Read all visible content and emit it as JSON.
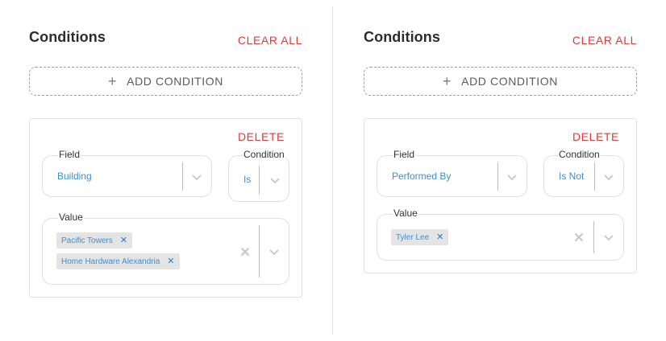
{
  "panels": [
    {
      "title": "Conditions",
      "clear_all_label": "CLEAR ALL",
      "add_condition_label": "ADD CONDITION",
      "condition": {
        "delete_label": "DELETE",
        "field": {
          "label": "Field",
          "value": "Building"
        },
        "operator": {
          "label": "Condition",
          "value": "Is"
        },
        "value": {
          "label": "Value",
          "chips": [
            "Pacific Towers",
            "Home Hardware Alexandria"
          ]
        }
      }
    },
    {
      "title": "Conditions",
      "clear_all_label": "CLEAR ALL",
      "add_condition_label": "ADD CONDITION",
      "condition": {
        "delete_label": "DELETE",
        "field": {
          "label": "Field",
          "value": "Performed By"
        },
        "operator": {
          "label": "Condition",
          "value": "Is Not"
        },
        "value": {
          "label": "Value",
          "chips": [
            "Tyler Lee"
          ]
        }
      }
    }
  ],
  "icons": {
    "add": "plus-icon",
    "dropdown": "chevron-down-icon",
    "clear": "close-icon",
    "chip_remove": "close-icon"
  },
  "colors": {
    "danger": "#e53935",
    "value_text": "#3a8fd6",
    "chip_bg": "#e4e4e4",
    "title": "#2c2c2c"
  }
}
